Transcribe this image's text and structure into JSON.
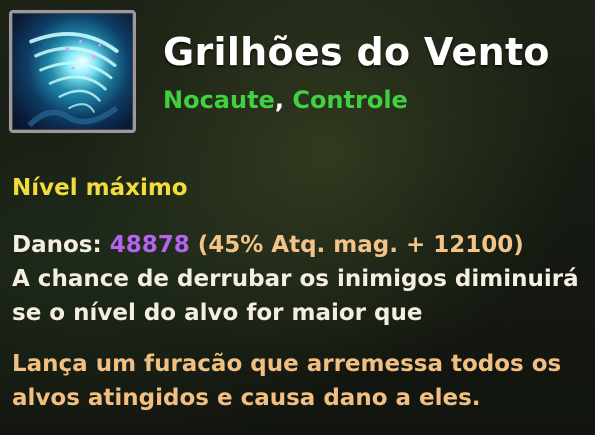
{
  "skill": {
    "icon": "tornado-icon",
    "name": "Grilhões do Vento",
    "tags": [
      "Nocaute",
      "Controle"
    ],
    "tag_separator": ", "
  },
  "level_label": "Nível máximo",
  "stats": {
    "damage_label": "Danos: ",
    "damage_value": "48878",
    "damage_formula": " (45% Atq. mag. + 12100)",
    "effect_text": "A chance de derrubar os inimigos diminuirá se o nível do alvo for maior que"
  },
  "description": "Lança um furacão que arremessa todos os alvos atingidos e causa dano a eles.",
  "colors": {
    "tag": "#3fd13f",
    "level": "#f2dc3c",
    "damage_value": "#b563f0",
    "description": "#f2bf80"
  }
}
